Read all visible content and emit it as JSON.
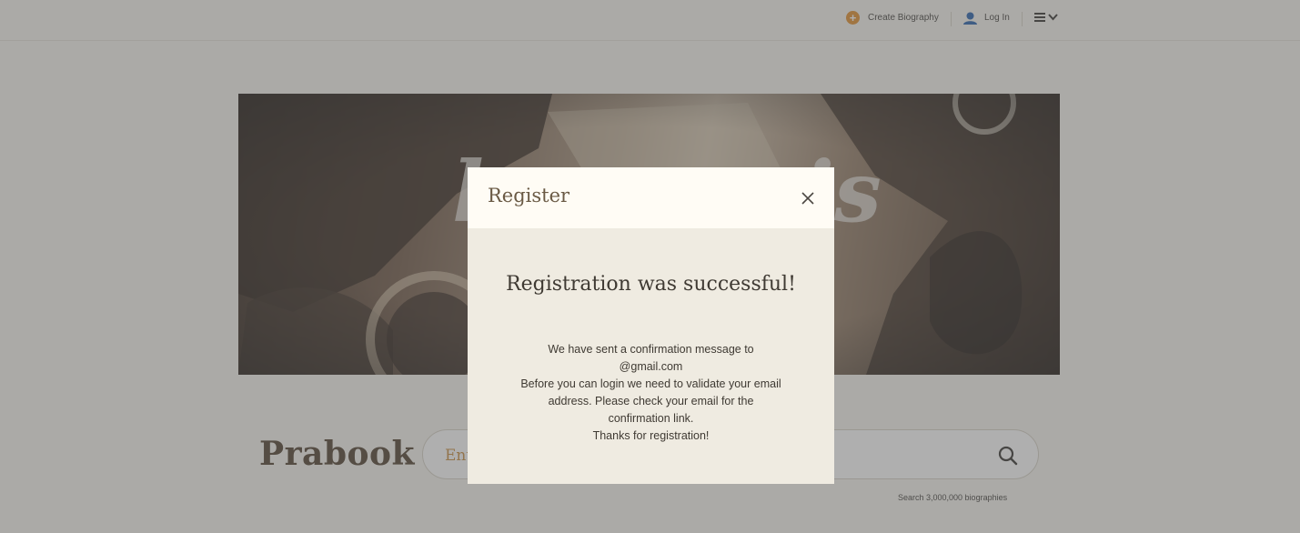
{
  "header": {
    "create_label": "Create Biography",
    "login_label": "Log In"
  },
  "brand": "Prabook",
  "search": {
    "placeholder": "Ent",
    "count_text": "Search 3,000,000 biographies"
  },
  "modal": {
    "title": "Register",
    "heading": "Registration was successful!",
    "lines": [
      "We have sent a confirmation message to",
      "@gmail.com",
      "Before you can login we need to validate your email",
      "address. Please check your email for the",
      "confirmation link.",
      "Thanks for registration!"
    ]
  },
  "colors": {
    "accent": "#e08a24",
    "login_icon": "#1e5aa8",
    "modal_header_bg": "#fffcf5",
    "modal_body_bg": "#efebe1"
  },
  "icons": {
    "create": "plus-circle-icon",
    "login": "user-icon",
    "menu": "hamburger-icon",
    "menu_caret": "chevron-down-icon",
    "search": "search-icon",
    "close": "close-icon"
  }
}
